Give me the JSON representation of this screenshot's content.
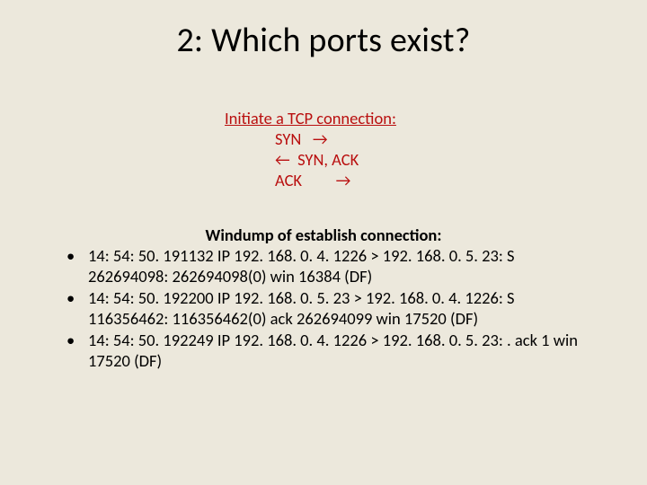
{
  "slide": {
    "title": "2: Which ports exist?",
    "handshake": {
      "heading": "Initiate a TCP connection:",
      "line_syn": "SYN   →",
      "line_synack": "←  SYN, ACK",
      "line_ack": "ACK         →"
    },
    "dump": {
      "heading": "Windump of establish connection:",
      "bullets": [
        "14: 54: 50. 191132 IP 192. 168. 0. 4. 1226 > 192. 168. 0. 5. 23: S 262694098: 262694098(0) win 16384 (DF)",
        "14: 54: 50. 192200 IP 192. 168. 0. 5. 23 > 192. 168. 0. 4. 1226: S 116356462: 116356462(0) ack 262694099 win 17520 (DF)",
        "14: 54: 50. 192249 IP 192. 168. 0. 4. 1226 > 192. 168. 0. 5. 23: . ack 1 win 17520 (DF)"
      ]
    }
  }
}
